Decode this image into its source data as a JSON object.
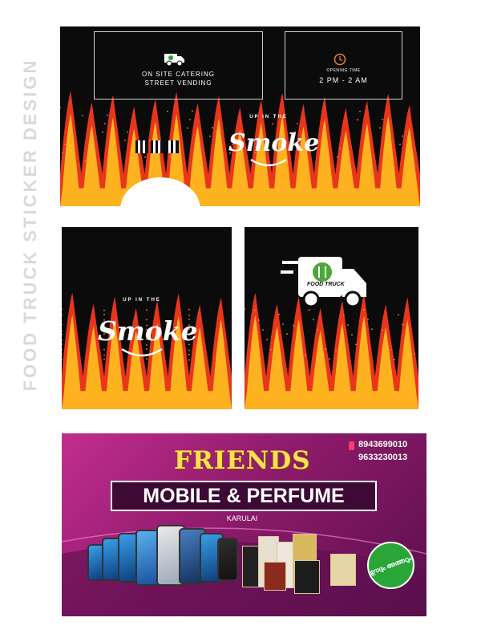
{
  "page_title": "FOOD TRUCK STICKER DESIGN",
  "panel1": {
    "services": [
      "ON SITE CATERING",
      "STREET VENDING"
    ],
    "opening_label": "OPENING TIME",
    "opening_time": "2 PM - 2 AM",
    "logo_top": "UP IN THE",
    "logo_main": "Smoke"
  },
  "panel2": {
    "logo_top": "UP IN THE",
    "logo_main": "Smoke"
  },
  "panel3": {
    "truck_label": "FOOD TRUCK"
  },
  "banner": {
    "title": "FRIENDS",
    "subtitle": "MOBILE & PERFUME",
    "town": "KARULAI",
    "phones": [
      "8943699010",
      "9633230013"
    ],
    "badge": "ഊദും അത്തറും"
  },
  "colors": {
    "panel_bg": "#0b0b0c",
    "flame_outer": "#e8361b",
    "flame_inner": "#ffb21f",
    "banner_title": "#ffe14a",
    "banner_bg": "#8e1b6b",
    "badge": "#2aa638"
  }
}
